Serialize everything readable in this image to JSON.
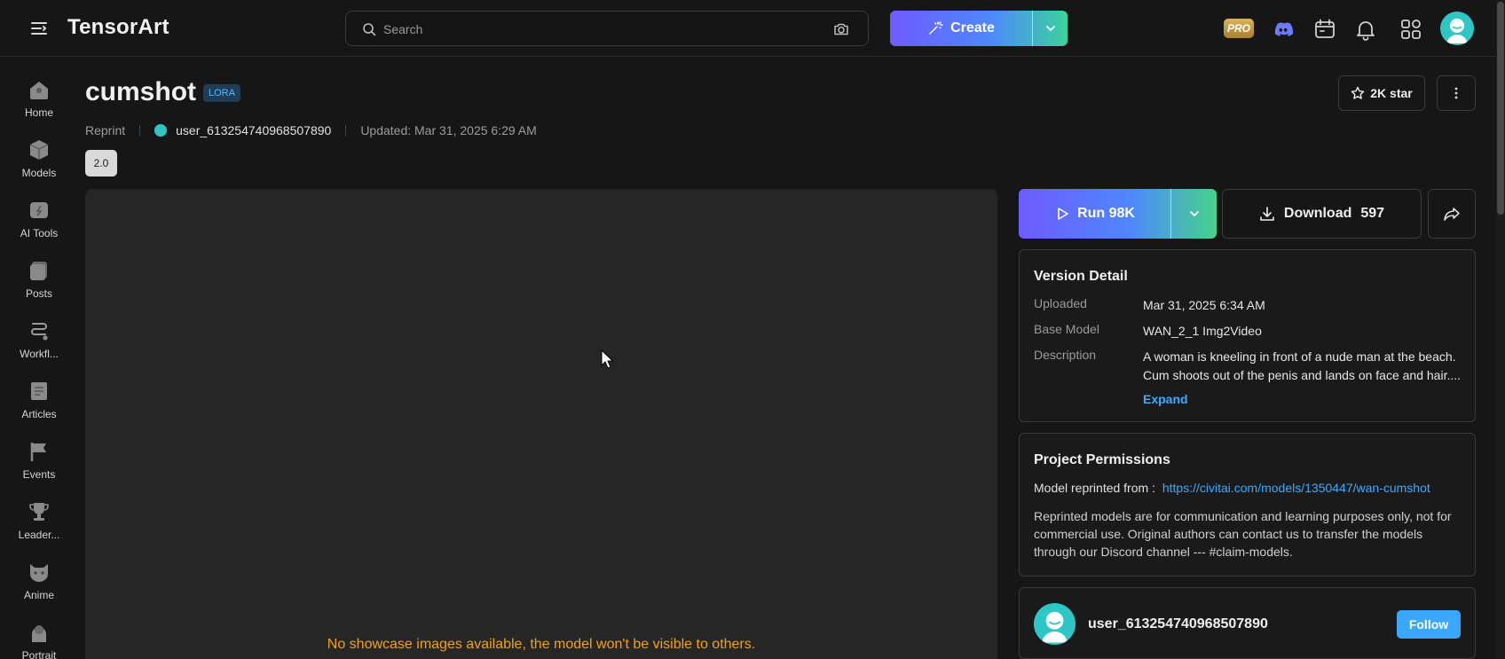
{
  "app": {
    "logo_text": "TensorArt"
  },
  "topbar": {
    "search_placeholder": "Search",
    "create_label": "Create",
    "pro_badge": "PRO",
    "icons": [
      "menu-icon",
      "camera-icon",
      "discord-icon",
      "calendar-icon",
      "bell-icon",
      "apps-icon"
    ]
  },
  "sidebar": {
    "items": [
      {
        "label": "Home",
        "icon": "home-icon"
      },
      {
        "label": "Models",
        "icon": "cube-icon"
      },
      {
        "label": "AI Tools",
        "icon": "tools-icon"
      },
      {
        "label": "Posts",
        "icon": "posts-icon"
      },
      {
        "label": "Workfl...",
        "icon": "workflow-icon"
      },
      {
        "label": "Articles",
        "icon": "articles-icon"
      },
      {
        "label": "Events",
        "icon": "flag-icon"
      },
      {
        "label": "Leader...",
        "icon": "trophy-icon"
      },
      {
        "label": "Anime",
        "icon": "cat-icon"
      },
      {
        "label": "Portrait",
        "icon": "portrait-icon"
      }
    ]
  },
  "model": {
    "title": "cumshot",
    "type_badge": "LORA",
    "source": "Reprint",
    "author": "user_613254740968507890",
    "updated": "Updated: Mar 31, 2025 6:29 AM",
    "version": "2.0",
    "star_label": "2K star"
  },
  "showcase": {
    "notice": "No showcase images available, the model won't be visible to others."
  },
  "actions": {
    "run_label": "Run 98K",
    "download_label": "Download",
    "download_count": "597"
  },
  "version_detail": {
    "heading": "Version Detail",
    "rows": [
      {
        "key": "Uploaded",
        "value": "Mar 31, 2025 6:34 AM"
      },
      {
        "key": "Base Model",
        "value": "WAN_2_1 Img2Video"
      },
      {
        "key": "Description",
        "value": "A woman is kneeling in front of a nude man at the beach. Cum shoots out of the penis and lands on face and hair...."
      }
    ],
    "expand_label": "Expand"
  },
  "permissions": {
    "heading": "Project Permissions",
    "reprinted_label": "Model reprinted from :",
    "reprinted_url": "https://civitai.com/models/1350447/wan-cumshot",
    "text": "Reprinted models are for communication and learning purposes only, not for commercial use. Original authors can contact us to transfer the models through our Discord channel --- #claim-models."
  },
  "creator": {
    "name": "user_613254740968507890",
    "follow_label": "Follow"
  },
  "colors": {
    "background": "#161616",
    "accent_blue": "#3da9ff",
    "warning": "#f0a21a",
    "gradient_start": "#6e5bff",
    "gradient_end": "#3bd39b"
  }
}
